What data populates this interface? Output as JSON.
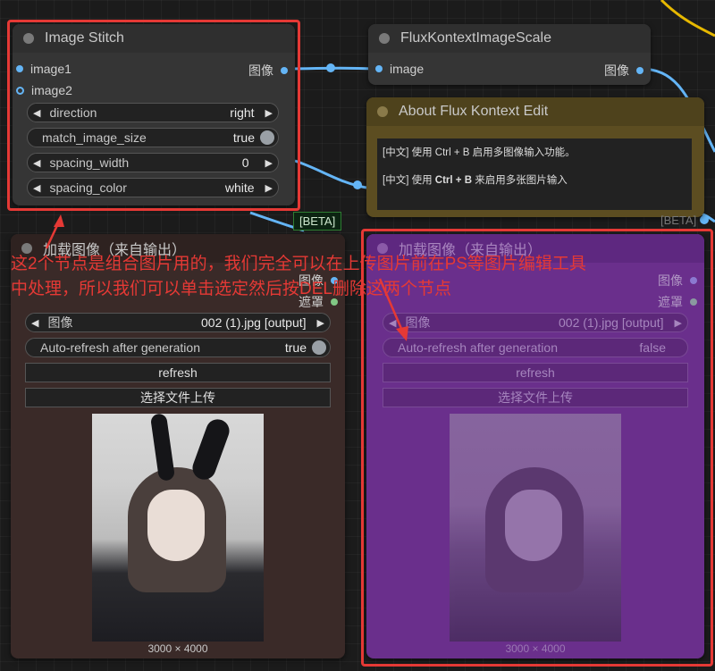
{
  "image_stitch": {
    "title": "Image Stitch",
    "input1": "image1",
    "input2": "image2",
    "output": "图像",
    "widgets": [
      {
        "label": "direction",
        "value": "right"
      },
      {
        "label": "match_image_size",
        "value": "true"
      },
      {
        "label": "spacing_width",
        "value": "0"
      },
      {
        "label": "spacing_color",
        "value": "white"
      }
    ]
  },
  "flux_scale": {
    "title": "FluxKontextImageScale",
    "input": "image",
    "output": "图像"
  },
  "about": {
    "title": "About Flux Kontext Edit",
    "line1": "[中文] 使用 Ctrl + B 启用多图像输入功能。",
    "line2_pre": "[中文] 使用 ",
    "line2_bold": "Ctrl + B",
    "line2_post": " 来启用多张图片输入"
  },
  "badges": {
    "beta": "[BETA]"
  },
  "load_left": {
    "title": "加载图像（来自输出）",
    "out_image": "图像",
    "out_mask": "遮罩",
    "image_label": "图像",
    "image_value": "002 (1).jpg [output]",
    "refresh_label": "Auto-refresh after generation",
    "refresh_value": "true",
    "btn_refresh": "refresh",
    "btn_upload": "选择文件上传",
    "dimensions": "3000 × 4000"
  },
  "load_right": {
    "title": "加载图像（来自输出）",
    "out_image": "图像",
    "out_mask": "遮罩",
    "image_label": "图像",
    "image_value": "002 (1).jpg [output]",
    "refresh_label": "Auto-refresh after generation",
    "refresh_value": "false",
    "btn_refresh": "refresh",
    "btn_upload": "选择文件上传",
    "dimensions": "3000 × 4000"
  },
  "annotation": {
    "line1": "这2个节点是组合图片用的，我们完全可以在上传图片前在PS等图片编辑工具",
    "line2": "中处理，所以我们可以单击选定然后按DEL删除这两个节点"
  },
  "colors": {
    "annotation": "#e53935",
    "link_image": "#64b5f6",
    "link_mask": "#81c784",
    "bypass": "#7b2a9e"
  }
}
